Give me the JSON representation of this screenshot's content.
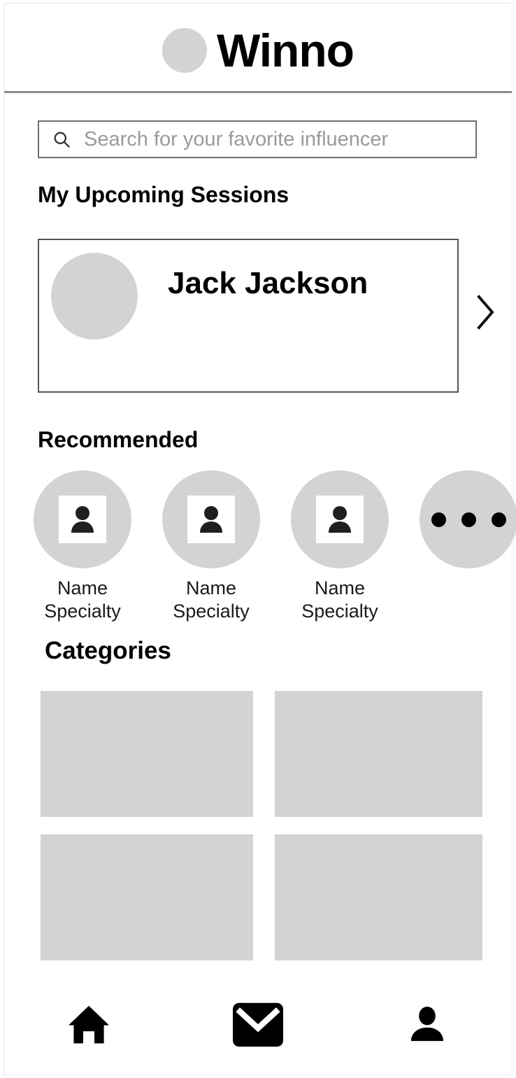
{
  "app": {
    "name": "Winno",
    "logo_icon": "circle-logo-mark"
  },
  "search": {
    "placeholder": "Search for your favorite influencer",
    "value": "",
    "icon": "search-icon"
  },
  "sections": {
    "sessions": {
      "heading": "My Upcoming Sessions",
      "next_icon": "chevron-right-icon",
      "card": {
        "name": "Jack Jackson",
        "avatar_icon": "avatar-placeholder"
      }
    },
    "recommended": {
      "heading": "Recommended",
      "items": [
        {
          "name": "Name",
          "specialty": "Specialty",
          "avatar_icon": "person-icon"
        },
        {
          "name": "Name",
          "specialty": "Specialty",
          "avatar_icon": "person-icon"
        },
        {
          "name": "Name",
          "specialty": "Specialty",
          "avatar_icon": "person-icon"
        }
      ],
      "more_icon": "more-dots-icon"
    },
    "categories": {
      "heading": "Categories",
      "tiles": [
        {
          "label": ""
        },
        {
          "label": ""
        },
        {
          "label": ""
        },
        {
          "label": ""
        }
      ]
    }
  },
  "bottom_nav": {
    "items": [
      {
        "icon": "home-icon",
        "label": ""
      },
      {
        "icon": "mail-icon",
        "label": ""
      },
      {
        "icon": "profile-icon",
        "label": ""
      }
    ]
  },
  "colors": {
    "placeholder_gray": "#d3d3d3",
    "text_black": "#000000",
    "border_gray": "#555555",
    "placeholder_text": "#9a9a9a"
  }
}
